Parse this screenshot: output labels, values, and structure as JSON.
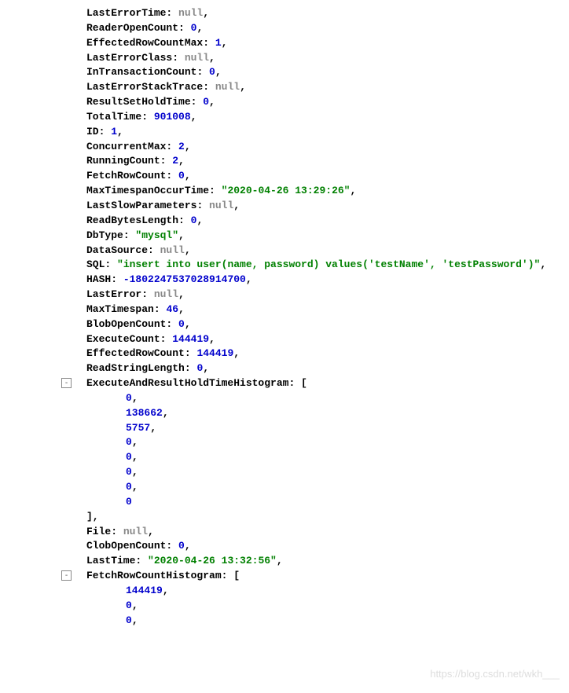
{
  "lines": [
    {
      "key": "LastErrorTime",
      "valType": "null",
      "val": "null"
    },
    {
      "key": "ReaderOpenCount",
      "valType": "num",
      "val": "0"
    },
    {
      "key": "EffectedRowCountMax",
      "valType": "num",
      "val": "1"
    },
    {
      "key": "LastErrorClass",
      "valType": "null",
      "val": "null"
    },
    {
      "key": "InTransactionCount",
      "valType": "num",
      "val": "0"
    },
    {
      "key": "LastErrorStackTrace",
      "valType": "null",
      "val": "null"
    },
    {
      "key": "ResultSetHoldTime",
      "valType": "num",
      "val": "0"
    },
    {
      "key": "TotalTime",
      "valType": "num",
      "val": "901008"
    },
    {
      "key": "ID",
      "valType": "num",
      "val": "1"
    },
    {
      "key": "ConcurrentMax",
      "valType": "num",
      "val": "2"
    },
    {
      "key": "RunningCount",
      "valType": "num",
      "val": "2"
    },
    {
      "key": "FetchRowCount",
      "valType": "num",
      "val": "0"
    },
    {
      "key": "MaxTimespanOccurTime",
      "valType": "str",
      "val": "\"2020-04-26 13:29:26\""
    },
    {
      "key": "LastSlowParameters",
      "valType": "null",
      "val": "null"
    },
    {
      "key": "ReadBytesLength",
      "valType": "num",
      "val": "0"
    },
    {
      "key": "DbType",
      "valType": "str",
      "val": "\"mysql\""
    },
    {
      "key": "DataSource",
      "valType": "null",
      "val": "null"
    },
    {
      "key": "SQL",
      "valType": "str",
      "val": "\"insert into user(name, password) values('testName', 'testPassword')\""
    },
    {
      "key": "HASH",
      "valType": "num",
      "val": "-1802247537028914700"
    },
    {
      "key": "LastError",
      "valType": "null",
      "val": "null"
    },
    {
      "key": "MaxTimespan",
      "valType": "num",
      "val": "46"
    },
    {
      "key": "BlobOpenCount",
      "valType": "num",
      "val": "0"
    },
    {
      "key": "ExecuteCount",
      "valType": "num",
      "val": "144419"
    },
    {
      "key": "EffectedRowCount",
      "valType": "num",
      "val": "144419"
    },
    {
      "key": "ReadStringLength",
      "valType": "num",
      "val": "0"
    }
  ],
  "arrays": [
    {
      "key": "ExecuteAndResultHoldTimeHistogram",
      "items": [
        "0",
        "138662",
        "5757",
        "0",
        "0",
        "0",
        "0",
        "0"
      ]
    }
  ],
  "lines2": [
    {
      "key": "File",
      "valType": "null",
      "val": "null"
    },
    {
      "key": "ClobOpenCount",
      "valType": "num",
      "val": "0"
    },
    {
      "key": "LastTime",
      "valType": "str",
      "val": "\"2020-04-26 13:32:56\""
    }
  ],
  "arrays2": [
    {
      "key": "FetchRowCountHistogram",
      "items": [
        "144419",
        "0",
        "0"
      ]
    }
  ],
  "watermark": "https://blog.csdn.net/wkh___"
}
